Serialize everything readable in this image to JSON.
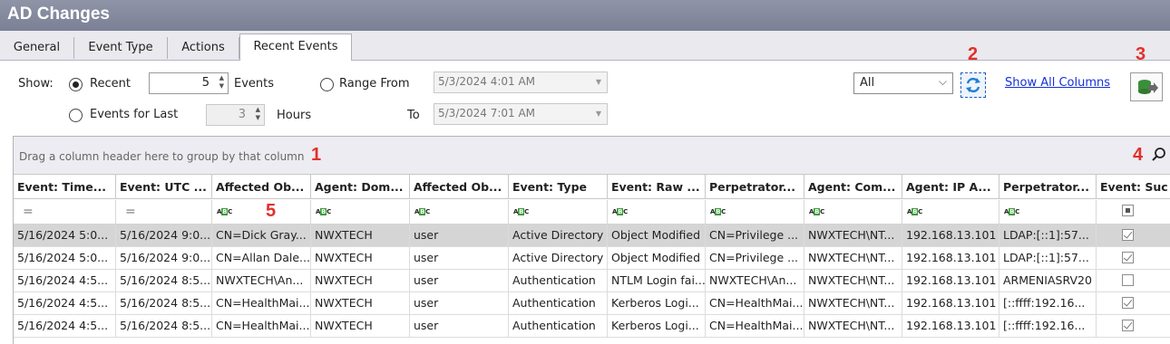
{
  "window": {
    "title": "AD Changes"
  },
  "tabs": [
    "General",
    "Event Type",
    "Actions",
    "Recent Events"
  ],
  "active_tab": "Recent Events",
  "filter": {
    "show_label": "Show:",
    "recent_label": "Recent",
    "recent_value": "5",
    "events_label": "Events",
    "range_label": "Range From",
    "range_from": "5/3/2024 4:01 AM",
    "to_label": "To",
    "range_to": "5/3/2024 7:01 AM",
    "events_for_last_label": "Events for Last",
    "hours_value": "3",
    "hours_label": "Hours",
    "selected_mode": "Recent"
  },
  "toolbar": {
    "scope_value": "All",
    "show_all_columns": "Show All Columns"
  },
  "annotations": {
    "a1": "1",
    "a2": "2",
    "a3": "3",
    "a4": "4",
    "a5": "5"
  },
  "grid": {
    "group_hint": "Drag a column header here to group by that column",
    "columns": [
      "Event: Time...",
      "Event: UTC ...",
      "Affected Ob...",
      "Agent: Dom...",
      "Affected Ob...",
      "Event: Type",
      "Event: Raw ...",
      "Perpetrator...",
      "Agent: Com...",
      "Agent: IP A...",
      "Perpetrator...",
      "Event: Suc"
    ],
    "rows": [
      {
        "cells": [
          "5/16/2024 5:0...",
          "5/16/2024 9:0...",
          "CN=Dick Gray...",
          "NWXTECH",
          "user",
          "Active Directory",
          "Object Modified",
          "CN=Privilege ...",
          "NWXTECH\\NT...",
          "192.168.13.101",
          "LDAP:[::1]:57..."
        ],
        "success": true,
        "selected": true
      },
      {
        "cells": [
          "5/16/2024 5:0...",
          "5/16/2024 9:0...",
          "CN=Allan Dale...",
          "NWXTECH",
          "user",
          "Active Directory",
          "Object Modified",
          "CN=Privilege ...",
          "NWXTECH\\NT...",
          "192.168.13.101",
          "LDAP:[::1]:57..."
        ],
        "success": true,
        "selected": false
      },
      {
        "cells": [
          "5/16/2024 4:5...",
          "5/16/2024 8:5...",
          "NWXTECH\\An...",
          "NWXTECH",
          "user",
          "Authentication",
          "NTLM Login fai...",
          "NWXTECH\\An...",
          "NWXTECH\\NT...",
          "192.168.13.101",
          "ARMENIASRV20"
        ],
        "success": false,
        "selected": false
      },
      {
        "cells": [
          "5/16/2024 4:5...",
          "5/16/2024 8:5...",
          "CN=HealthMai...",
          "NWXTECH",
          "user",
          "Authentication",
          "Kerberos Logi...",
          "CN=HealthMai...",
          "NWXTECH\\NT...",
          "192.168.13.101",
          "[::ffff:192.16..."
        ],
        "success": true,
        "selected": false
      },
      {
        "cells": [
          "5/16/2024 4:5...",
          "5/16/2024 8:5...",
          "CN=HealthMai...",
          "NWXTECH",
          "user",
          "Authentication",
          "Kerberos Logi...",
          "CN=HealthMai...",
          "NWXTECH\\NT...",
          "192.168.13.101",
          "[::ffff:192.16..."
        ],
        "success": true,
        "selected": false
      }
    ]
  }
}
